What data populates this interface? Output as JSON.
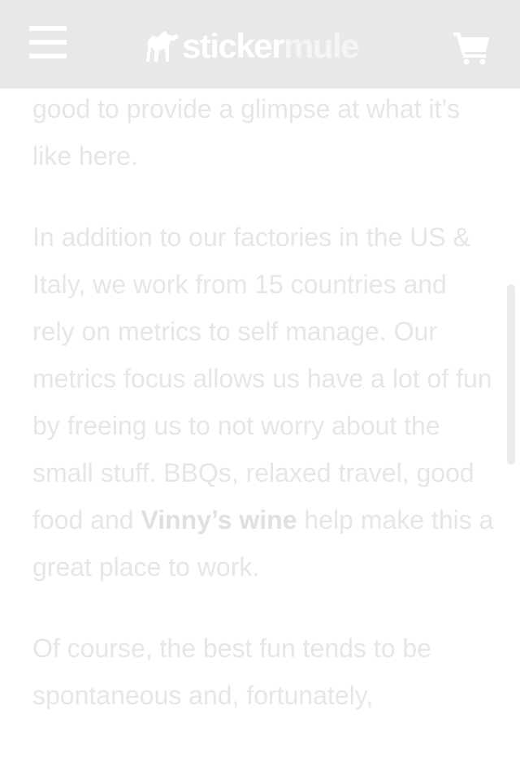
{
  "header": {
    "menu_icon": "hamburger-menu-icon",
    "logo_text_sticker": "sticker",
    "logo_text_mule": "mule",
    "logo_icon": "mule-logo-icon",
    "cart_icon": "shopping-cart-icon"
  },
  "article": {
    "para1": "good to provide a glimpse at what it’s like here.",
    "para2_before": "In addition to our factories in the US & Italy, we work from 15 countries and rely on metrics to self manage. Our metrics focus allows us have a lot of fun by freeing us to not worry about the small stuff. BBQs, relaxed travel, good food and ",
    "para2_link": "Vinny’s wine",
    "para2_after": " help make this a great place to work.",
    "para3": "Of course, the best fun tends to be spontaneous and, fortunately,"
  },
  "colors": {
    "header_bg": "#e8e8e8",
    "text": "#e6e6e6",
    "logo": "#ffffff"
  }
}
